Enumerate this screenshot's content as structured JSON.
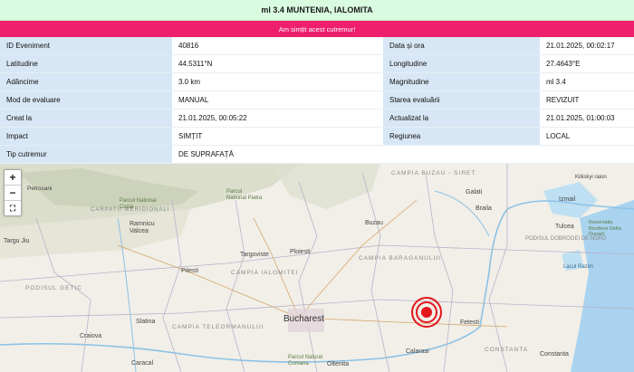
{
  "header": {
    "title": "ml 3.4 MUNTENIA, IALOMITA",
    "felt_button": "Am simțit acest cutremur!"
  },
  "details": {
    "rows": [
      {
        "l1": "ID Eveniment",
        "v1": "40816",
        "l2": "Data și ora",
        "v2": "21.01.2025, 00:02:17"
      },
      {
        "l1": "Latitudine",
        "v1": "44.5311°N",
        "l2": "Longitudine",
        "v2": "27.4643°E"
      },
      {
        "l1": "Adâncime",
        "v1": "3.0 km",
        "l2": "Magnitudine",
        "v2": "ml 3.4"
      },
      {
        "l1": "Mod de evaluare",
        "v1": "MANUAL",
        "l2": "Starea evaluării",
        "v2": "REVIZUIT"
      },
      {
        "l1": "Creat la",
        "v1": "21.01.2025, 00:05:22",
        "l2": "Actualizat la",
        "v2": "21.01.2025, 01:00:03"
      },
      {
        "l1": "Impact",
        "v1": "SIMȚIT",
        "l2": "Regiunea",
        "v2": "LOCAL"
      }
    ],
    "last_row": {
      "l1": "Tip cutremur",
      "v1": "DE SUPRAFAȚĂ"
    }
  },
  "map": {
    "zoom_in": "+",
    "zoom_out": "−",
    "fullscreen": "⛶",
    "marker_color": "#e3161c",
    "labels": {
      "campia_buzau_siret": "CAMPIA BUZAU - SIRET",
      "campia_baraganului": "CAMPIA BARAGANULUI",
      "campia_ialomitei": "CAMPIA IALOMITEI",
      "campia_teleormanului": "CAMPIA TELEORMANULUI",
      "podisul_getic": "PODISUL GETIC",
      "podisul_dobrogei": "PODISUL DOBROGEI DE NORD",
      "carpatii_meridionali": "CARPATII MERIDIONALI",
      "bucharest": "Bucharest",
      "buzau": "Buzau",
      "galati": "Galati",
      "braila": "Braila",
      "ploiesti": "Ploiesti",
      "targoviste": "Targoviste",
      "pitesti": "Pitesti",
      "ramnicu_valcea": "Ramnicu Valcea",
      "targu_jiu": "Targu Jiu",
      "craiova": "Craiova",
      "slatina": "Slatina",
      "caracal": "Caracal",
      "calarasi": "Calarasi",
      "fetesti": "Fetesti",
      "constanta_region": "CONSTANTA",
      "constanta": "Constanta",
      "tulcea": "Tulcea",
      "izmail": "Izmail",
      "kiliia": "Kiliiskyi raion",
      "petrosani": "Petrosani",
      "parcul_buila": "Parcul National Cozia",
      "parcul_piatra": "Parcul National Piatra",
      "parcul_comana": "Parcul Natural Comana",
      "oltenita": "Oltenita",
      "lacul_razim": "Lacul Razim",
      "rezervatia": "Rezervatia Biosferei Delta Dunarii"
    }
  }
}
